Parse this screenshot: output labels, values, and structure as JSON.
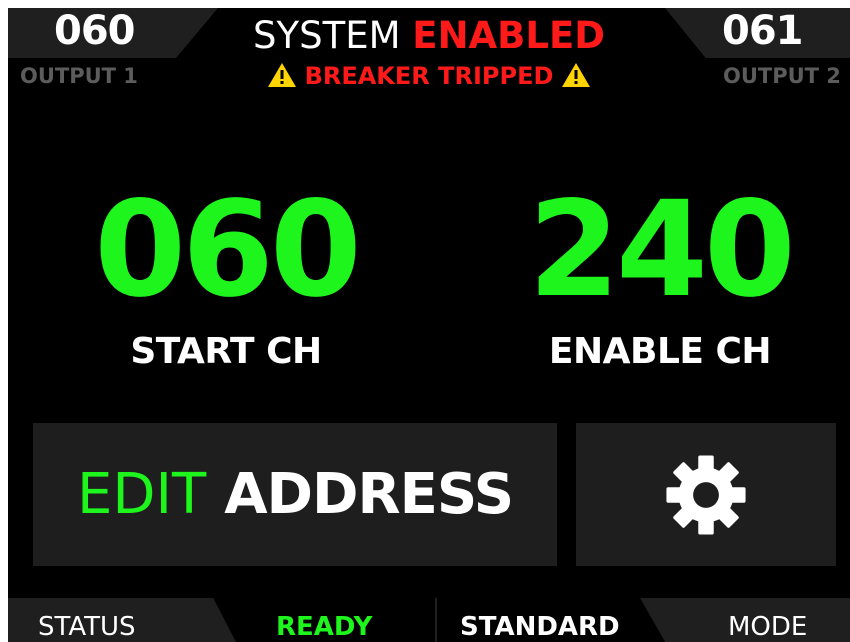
{
  "colors": {
    "background": "#000000",
    "panel": "#1e1e1e",
    "accent_green": "#1df51d",
    "alert_red": "#ff1a1a",
    "muted_label": "#5c5c5c",
    "warning_yellow": "#ffd400",
    "text": "#ffffff"
  },
  "header": {
    "output1": {
      "value": "060",
      "label": "OUTPUT 1"
    },
    "output2": {
      "value": "061",
      "label": "OUTPUT 2"
    },
    "system_prefix": "SYSTEM",
    "system_state": "ENABLED",
    "warning_text": "BREAKER TRIPPED",
    "warning_icon": "warning-triangle-icon"
  },
  "main": {
    "start_channel": {
      "value": "060",
      "label": "START CH"
    },
    "enable_channel": {
      "value": "240",
      "label": "ENABLE CH"
    }
  },
  "buttons": {
    "edit_word": "EDIT",
    "address_word": "ADDRESS",
    "settings_icon": "gear-icon"
  },
  "status_bar": {
    "status_label": "STATUS",
    "status_value": "READY",
    "mode_value": "STANDARD",
    "mode_label": "MODE"
  }
}
